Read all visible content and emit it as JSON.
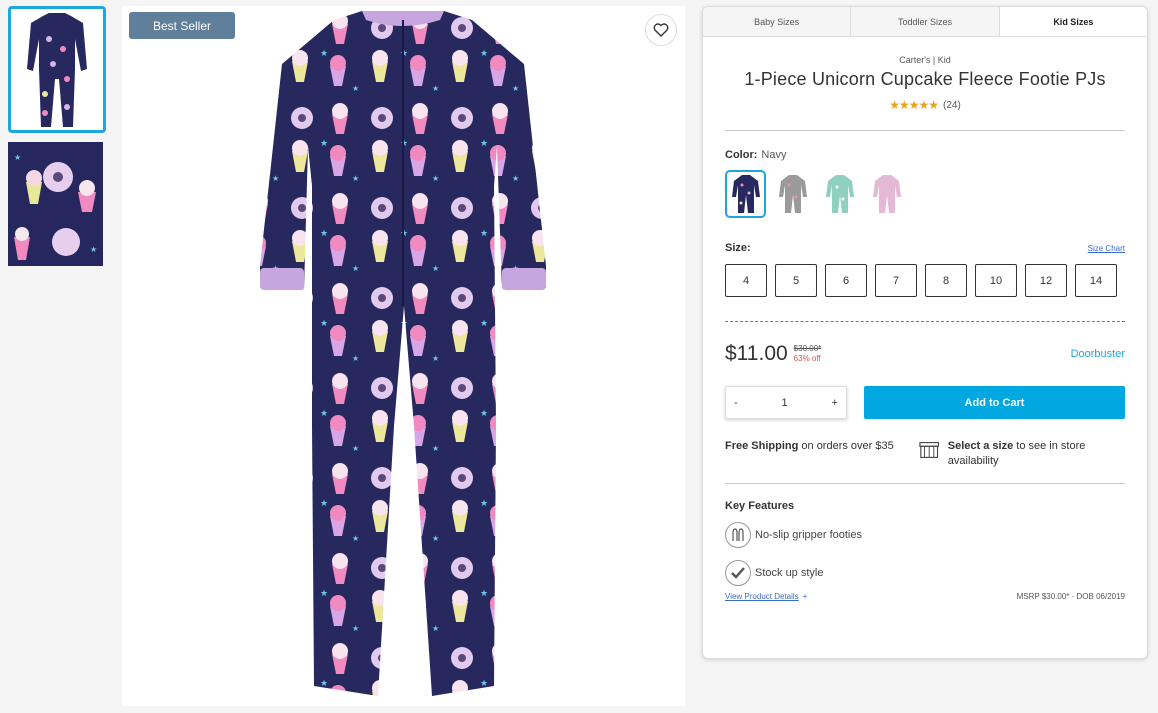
{
  "badge": "Best Seller",
  "size_tabs": [
    "Baby Sizes",
    "Toddler Sizes",
    "Kid Sizes"
  ],
  "brand": "Carter's | Kid",
  "title": "1-Piece Unicorn Cupcake Fleece Footie PJs",
  "rating": {
    "stars": "★★★★★",
    "count": "(24)"
  },
  "color": {
    "label": "Color:",
    "value": "Navy",
    "swatches": [
      "#27285e",
      "#9a9a9a",
      "#8fd0c0",
      "#e4b9d3"
    ]
  },
  "size": {
    "label": "Size:",
    "chart_link": "Size Chart",
    "options": [
      "4",
      "5",
      "6",
      "7",
      "8",
      "10",
      "12",
      "14"
    ]
  },
  "price": {
    "current": "$11.00",
    "was": "$30.00*",
    "off": "63% off",
    "promo": "Doorbuster"
  },
  "quantity": {
    "minus": "-",
    "value": "1",
    "plus": "+"
  },
  "add_to_cart": "Add to Cart",
  "shipping": {
    "bold": "Free Shipping",
    "rest": " on orders over $35"
  },
  "store": {
    "bold": "Select a size",
    "rest": " to see in store availability"
  },
  "features": {
    "title": "Key Features",
    "items": [
      "No-slip gripper footies",
      "Stock up style"
    ]
  },
  "footer": {
    "details": "View Product Details",
    "plus": "+",
    "msrp": "MSRP $30.00* · DOB 06/2019"
  },
  "colors": {
    "accent": "#1ea7dc",
    "cart": "#00a7e1",
    "badge": "#5f7f9a",
    "sale": "#d9534f",
    "star": "#e8a317"
  }
}
